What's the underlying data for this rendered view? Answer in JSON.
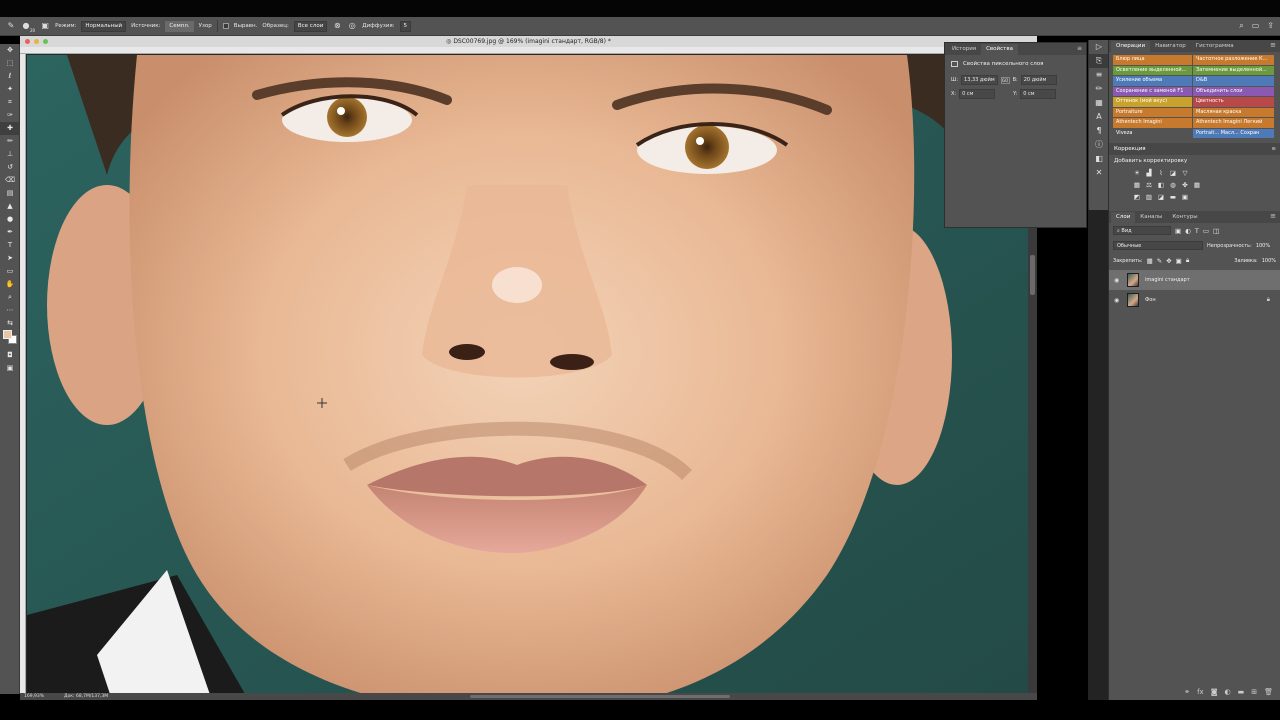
{
  "options_bar": {
    "brush_size": "20",
    "mode_label": "Режим:",
    "mode_value": "Нормальный",
    "source_label": "Источник:",
    "source_btn1": "Семпл.",
    "source_btn2": "Узор",
    "aligned_label": "Выравн.",
    "sample_label": "Образец:",
    "sample_value": "Все слои",
    "diffusion_label": "Диффузия:",
    "diffusion_value": "5"
  },
  "document": {
    "title": "◎ DSC00769.jpg @ 169% (imagini стандарт, RGB/8) *",
    "zoom": "169,93%",
    "doc_size": "Док: 68,7M/137,3M"
  },
  "properties": {
    "tabs": [
      "История",
      "Свойства"
    ],
    "active_tab": "Свойства",
    "heading": "Свойства пиксельного слоя",
    "w_label": "Ш:",
    "w_value": "13,33 дюйм",
    "h_label": "В:",
    "h_value": "20 дюйм",
    "x_label": "X:",
    "x_value": "0 см",
    "y_label": "Y:",
    "y_value": "0 см",
    "link_label": "GO"
  },
  "actions_panel": {
    "tabs": [
      "Операции",
      "Навигатор",
      "Гистограмма"
    ],
    "active_tab": "Операции",
    "buttons": [
      {
        "label": "Блюр лица",
        "color": "#c77a2d"
      },
      {
        "label": "Частотное разложение К...",
        "color": "#c77a2d"
      },
      {
        "label": "Осветление выделенной...",
        "color": "#6a9a3d"
      },
      {
        "label": "Затемнение выделенной...",
        "color": "#6a9a3d"
      },
      {
        "label": "Усиление объема",
        "color": "#4f7ab8"
      },
      {
        "label": "D&B",
        "color": "#4f7ab8"
      },
      {
        "label": "Сохранение с заменой    F1",
        "color": "#8a5ab2"
      },
      {
        "label": "Объединить слои",
        "color": "#8a5ab2"
      },
      {
        "label": "Оттенок (мой вкус)",
        "color": "#c9a22e"
      },
      {
        "label": "Цветность",
        "color": "#b94848"
      },
      {
        "label": "Portraiture",
        "color": "#c77a2d"
      },
      {
        "label": "Масляная краска",
        "color": "#c77a2d"
      },
      {
        "label": "Athentech Imagini",
        "color": "#c77a2d"
      },
      {
        "label": "Athentech Imagini Легкий",
        "color": "#c77a2d"
      },
      {
        "label": "Viveza",
        "color": "#535353"
      },
      {
        "label": "Portrait... Масл... Сохран",
        "color": "#4f7ab8"
      }
    ]
  },
  "correction": {
    "title": "Коррекция",
    "add_label": "Добавить корректировку"
  },
  "layers_panel": {
    "tabs": [
      "Слои",
      "Каналы",
      "Контуры"
    ],
    "active_tab": "Слои",
    "kind_label": "Вид",
    "blend_mode": "Обычные",
    "opacity_label": "Непрозрачность:",
    "opacity_value": "100%",
    "lock_label": "Закрепить:",
    "fill_label": "Заливка:",
    "fill_value": "100%",
    "layers": [
      {
        "name": "imagini стандарт",
        "selected": true,
        "locked": false
      },
      {
        "name": "Фон",
        "selected": false,
        "locked": true
      }
    ]
  }
}
